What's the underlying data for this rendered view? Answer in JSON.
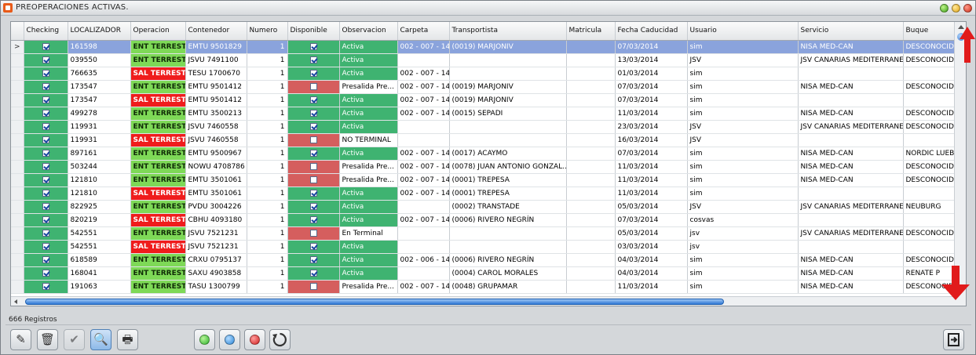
{
  "window": {
    "title": "PREOPERACIONES ACTIVAS.",
    "colors": {
      "ent": "#7ed957",
      "sal": "#ef1c1c",
      "disp_ok": "#3fb371",
      "disp_no": "#d55e5e",
      "selection": "#8aa3dc"
    }
  },
  "grid": {
    "columns": [
      "",
      "Checking",
      "LOCALIZADOR",
      "Operacion",
      "Contenedor",
      "Numero",
      "Disponible",
      "Observacion",
      "Carpeta",
      "Transportista",
      "Matricula",
      "Fecha Caducidad",
      "Usuario",
      "Servicio",
      "Buque"
    ],
    "rows": [
      {
        "ind": ">",
        "loc": "161598",
        "op": "ENT TERRESTRE",
        "cont": "EMTU 9501829",
        "num": "1",
        "disp": true,
        "obs": "Activa",
        "carp": "002 - 007 - 14",
        "trans": "(0019) MARJONIV",
        "mat": "",
        "fecha": "07/03/2014",
        "usr": "sim",
        "serv": "NISA MED-CAN",
        "buque": "DESCONOCIDO"
      },
      {
        "ind": "",
        "loc": "039550",
        "op": "ENT TERRESTRE",
        "cont": "JSVU 7491100",
        "num": "1",
        "disp": true,
        "obs": "Activa",
        "carp": "",
        "trans": "",
        "mat": "",
        "fecha": "13/03/2014",
        "usr": "JSV",
        "serv": "JSV CANARIAS MEDITERRANEO",
        "buque": "DESCONOCIDO"
      },
      {
        "ind": "",
        "loc": "766635",
        "op": "SAL TERRESTRE",
        "cont": "TESU 1700670",
        "num": "1",
        "disp": true,
        "obs": "Activa",
        "carp": "002 - 007 - 14",
        "trans": "",
        "mat": "",
        "fecha": "01/03/2014",
        "usr": "sim",
        "serv": "",
        "buque": ""
      },
      {
        "ind": "",
        "loc": "173547",
        "op": "ENT TERRESTRE",
        "cont": "EMTU 9501412",
        "num": "1",
        "disp": false,
        "obs": "Presalida Pre...",
        "carp": "002 - 007 - 14",
        "trans": "(0019) MARJONIV",
        "mat": "",
        "fecha": "07/03/2014",
        "usr": "sim",
        "serv": "NISA MED-CAN",
        "buque": "DESCONOCIDO"
      },
      {
        "ind": "",
        "loc": "173547",
        "op": "SAL TERRESTRE",
        "cont": "EMTU 9501412",
        "num": "1",
        "disp": true,
        "obs": "Activa",
        "carp": "002 - 007 - 14",
        "trans": "(0019) MARJONIV",
        "mat": "",
        "fecha": "07/03/2014",
        "usr": "sim",
        "serv": "",
        "buque": ""
      },
      {
        "ind": "",
        "loc": "499278",
        "op": "ENT TERRESTRE",
        "cont": "EMTU 3500213",
        "num": "1",
        "disp": true,
        "obs": "Activa",
        "carp": "002 - 007 - 14",
        "trans": "(0015) SEPADI",
        "mat": "",
        "fecha": "11/03/2014",
        "usr": "sim",
        "serv": "NISA MED-CAN",
        "buque": "DESCONOCIDO"
      },
      {
        "ind": "",
        "loc": "119931",
        "op": "ENT TERRESTRE",
        "cont": "JSVU 7460558",
        "num": "1",
        "disp": true,
        "obs": "Activa",
        "carp": "",
        "trans": "",
        "mat": "",
        "fecha": "23/03/2014",
        "usr": "JSV",
        "serv": "JSV CANARIAS MEDITERRANEO",
        "buque": "DESCONOCIDO"
      },
      {
        "ind": "",
        "loc": "119931",
        "op": "SAL TERRESTRE",
        "cont": "JSVU 7460558",
        "num": "1",
        "disp": false,
        "obs": "NO TERMINAL",
        "carp": "",
        "trans": "",
        "mat": "",
        "fecha": "16/03/2014",
        "usr": "JSV",
        "serv": "",
        "buque": ""
      },
      {
        "ind": "",
        "loc": "897161",
        "op": "ENT TERRESTRE",
        "cont": "EMTU 9500967",
        "num": "1",
        "disp": true,
        "obs": "Activa",
        "carp": "002 - 007 - 14",
        "trans": "(0017) ACAYMO",
        "mat": "",
        "fecha": "07/03/2014",
        "usr": "sim",
        "serv": "NISA MED-CAN",
        "buque": "NORDIC LUEB..."
      },
      {
        "ind": "",
        "loc": "503244",
        "op": "ENT TERRESTRE",
        "cont": "NOWU 4708786",
        "num": "1",
        "disp": false,
        "obs": "Presalida Pre...",
        "carp": "002 - 007 - 14",
        "trans": "(0078) JUAN ANTONIO GONZAL...",
        "mat": "",
        "fecha": "11/03/2014",
        "usr": "sim",
        "serv": "NISA MED-CAN",
        "buque": "DESCONOCIDO"
      },
      {
        "ind": "",
        "loc": "121810",
        "op": "ENT TERRESTRE",
        "cont": "EMTU 3501061",
        "num": "1",
        "disp": false,
        "obs": "Presalida Pre...",
        "carp": "002 - 007 - 14",
        "trans": "(0001) TREPESA",
        "mat": "",
        "fecha": "11/03/2014",
        "usr": "sim",
        "serv": "NISA MED-CAN",
        "buque": "DESCONOCIDO"
      },
      {
        "ind": "",
        "loc": "121810",
        "op": "SAL TERRESTRE",
        "cont": "EMTU 3501061",
        "num": "1",
        "disp": true,
        "obs": "Activa",
        "carp": "002 - 007 - 14",
        "trans": "(0001) TREPESA",
        "mat": "",
        "fecha": "11/03/2014",
        "usr": "sim",
        "serv": "",
        "buque": ""
      },
      {
        "ind": "",
        "loc": "822925",
        "op": "ENT TERRESTRE",
        "cont": "PVDU 3004226",
        "num": "1",
        "disp": true,
        "obs": "Activa",
        "carp": "",
        "trans": "(0002) TRANSTADE",
        "mat": "",
        "fecha": "05/03/2014",
        "usr": "JSV",
        "serv": "JSV CANARIAS MEDITERRANEO",
        "buque": "NEUBURG"
      },
      {
        "ind": "",
        "loc": "820219",
        "op": "SAL TERRESTRE",
        "cont": "CBHU 4093180",
        "num": "1",
        "disp": true,
        "obs": "Activa",
        "carp": "002 - 007 - 14",
        "trans": "(0006) RIVERO NEGRÍN",
        "mat": "",
        "fecha": "07/03/2014",
        "usr": "cosvas",
        "serv": "",
        "buque": ""
      },
      {
        "ind": "",
        "loc": "542551",
        "op": "ENT TERRESTRE",
        "cont": "JSVU 7521231",
        "num": "1",
        "disp": false,
        "obs": "En Terminal",
        "carp": "",
        "trans": "",
        "mat": "",
        "fecha": "05/03/2014",
        "usr": "jsv",
        "serv": "JSV CANARIAS MEDITERRANEO",
        "buque": "DESCONOCIDO"
      },
      {
        "ind": "",
        "loc": "542551",
        "op": "SAL TERRESTRE",
        "cont": "JSVU 7521231",
        "num": "1",
        "disp": true,
        "obs": "Activa",
        "carp": "",
        "trans": "",
        "mat": "",
        "fecha": "03/03/2014",
        "usr": "jsv",
        "serv": "",
        "buque": ""
      },
      {
        "ind": "",
        "loc": "618589",
        "op": "ENT TERRESTRE",
        "cont": "CRXU 0795137",
        "num": "1",
        "disp": true,
        "obs": "Activa",
        "carp": "002 - 006 - 14",
        "trans": "(0006) RIVERO NEGRÍN",
        "mat": "",
        "fecha": "04/03/2014",
        "usr": "sim",
        "serv": "NISA MED-CAN",
        "buque": "DESCONOCIDO"
      },
      {
        "ind": "",
        "loc": "168041",
        "op": "ENT TERRESTRE",
        "cont": "SAXU 4903858",
        "num": "1",
        "disp": true,
        "obs": "Activa",
        "carp": "",
        "trans": "(0004) CAROL MORALES",
        "mat": "",
        "fecha": "04/03/2014",
        "usr": "sim",
        "serv": "NISA MED-CAN",
        "buque": "RENATE P"
      },
      {
        "ind": "",
        "loc": "191063",
        "op": "ENT TERRESTRE",
        "cont": "TASU 1300799",
        "num": "1",
        "disp": false,
        "obs": "Presalida Pre...",
        "carp": "002 - 007 - 14",
        "trans": "(0048) GRUPAMAR",
        "mat": "",
        "fecha": "11/03/2014",
        "usr": "sim",
        "serv": "NISA MED-CAN",
        "buque": "DESCONOCIDO"
      }
    ]
  },
  "status": {
    "records": "666 Registros"
  },
  "toolbar": {
    "buttons": [
      {
        "name": "edit-button",
        "icon": "pencil-icon",
        "glyph": "✎"
      },
      {
        "name": "delete-button",
        "icon": "trash-icon",
        "glyph": "🗑"
      },
      {
        "name": "confirm-button",
        "icon": "check-icon",
        "glyph": "✔"
      },
      {
        "name": "search-button",
        "icon": "magnifier-icon",
        "glyph": "🔍"
      },
      {
        "name": "print-button",
        "icon": "printer-icon",
        "glyph": "🖶"
      }
    ]
  }
}
